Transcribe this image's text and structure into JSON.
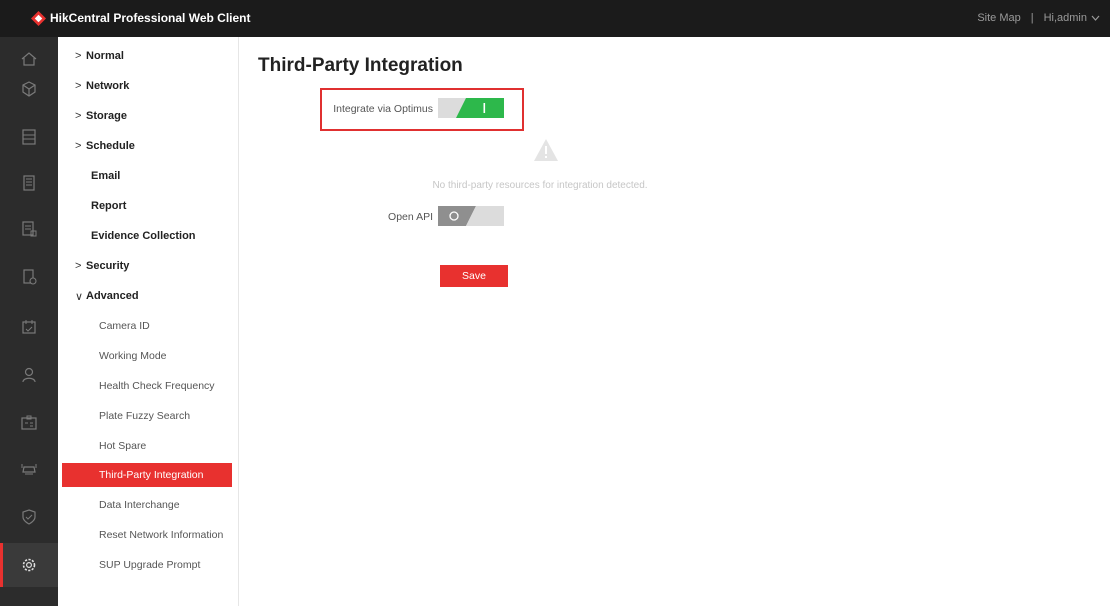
{
  "header": {
    "app_title": "HikCentral Professional Web Client",
    "site_map": "Site Map",
    "separator": "|",
    "user": "Hi,admin",
    "brand_color": "#e8312f"
  },
  "rail": {
    "icons": [
      "home-icon",
      "cube-icon",
      "server-icon",
      "building-icon",
      "document-list-icon",
      "device-clock-icon",
      "calendar-icon",
      "person-icon",
      "id-card-icon",
      "vehicle-icon",
      "shield-icon",
      "gear-icon"
    ],
    "active": "gear-icon"
  },
  "nav": {
    "groups": [
      {
        "label": "Normal",
        "arrow": ">"
      },
      {
        "label": "Network",
        "arrow": ">"
      },
      {
        "label": "Storage",
        "arrow": ">"
      },
      {
        "label": "Schedule",
        "arrow": ">"
      },
      {
        "label": "Email",
        "arrow": ""
      },
      {
        "label": "Report",
        "arrow": ""
      },
      {
        "label": "Evidence Collection",
        "arrow": ""
      },
      {
        "label": "Security",
        "arrow": ">"
      },
      {
        "label": "Advanced",
        "arrow": "∨"
      }
    ],
    "advanced_items": [
      "Camera ID",
      "Working Mode",
      "Health Check Frequency",
      "Plate Fuzzy Search",
      "Hot Spare",
      "Third-Party Integration",
      "Data Interchange",
      "Reset Network Information",
      "SUP Upgrade Prompt"
    ],
    "active_item": "Third-Party Integration"
  },
  "main": {
    "title": "Third-Party Integration",
    "optimus_label": "Integrate via Optimus",
    "optimus_enabled": true,
    "notice": "No third-party resources for integration detected.",
    "open_api_label": "Open API",
    "open_api_enabled": false,
    "save_label": "Save",
    "toggle_on_color": "#2db84b",
    "toggle_off_color": "#c8c8c8"
  }
}
